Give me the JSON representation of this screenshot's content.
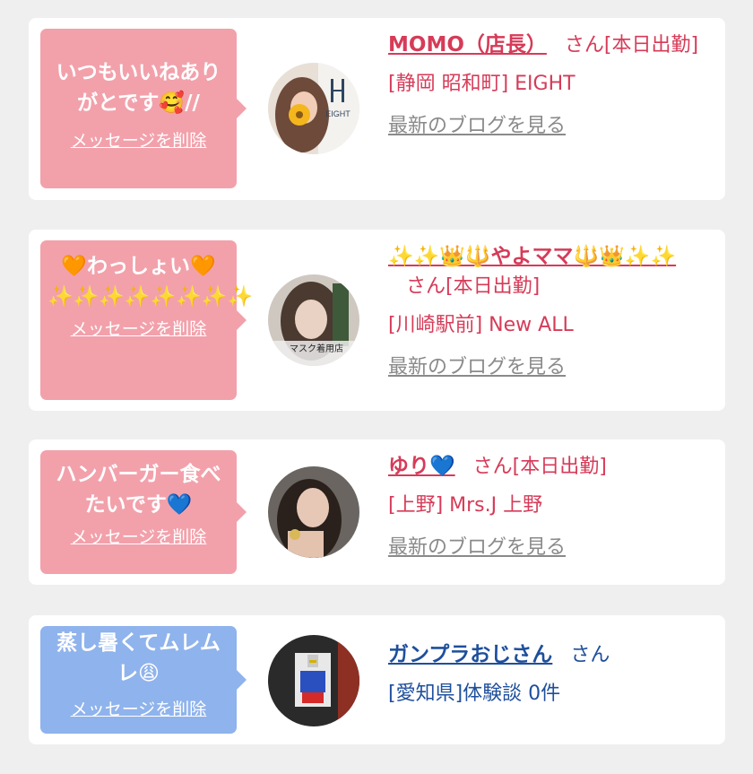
{
  "cards": [
    {
      "message": "いつもいいねありがとです🥰//",
      "delete_label": "メッセージを削除",
      "name": "MOMO（店長）",
      "honorific": "さん[本日出勤]",
      "shop": "[静岡 昭和町] EIGHT",
      "blog_link": "最新のブログを見る",
      "avatar_label": "EIGHT"
    },
    {
      "message": "🧡わっしょい🧡✨✨✨✨✨✨✨✨",
      "delete_label": "メッセージを削除",
      "name": "✨✨👑🔱やよママ🔱👑✨✨",
      "honorific": "さん[本日出勤]",
      "shop": "[川崎駅前] New ALL",
      "blog_link": "最新のブログを見る",
      "avatar_label": "マスク着用店"
    },
    {
      "message": "ハンバーガー食べたいです💙",
      "delete_label": "メッセージを削除",
      "name": "ゆり💙",
      "honorific": "さん[本日出勤]",
      "shop": "[上野] Mrs.J 上野",
      "blog_link": "最新のブログを見る"
    },
    {
      "message": "蒸し暑くてムレムレ😩",
      "delete_label": "メッセージを削除",
      "name": "ガンプラおじさん",
      "honorific": "さん",
      "shop": "[愛知県]体験談 0件"
    }
  ],
  "colors": {
    "pink_bubble": "#f2a1ab",
    "blue_bubble": "#8fb3ec",
    "pink_text": "#d63b58",
    "blue_text": "#1e4f9c",
    "link_gray": "#8a8a8a"
  }
}
